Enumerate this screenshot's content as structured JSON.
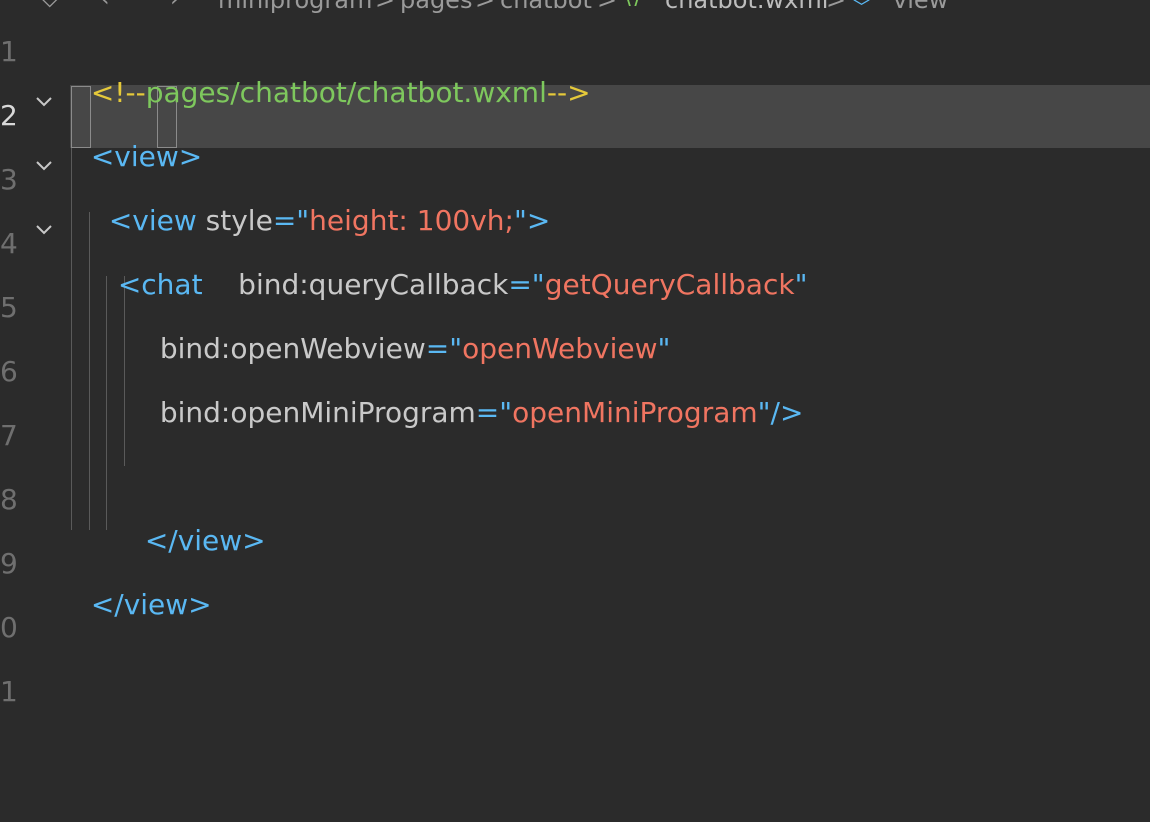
{
  "breadcrumb": {
    "items": [
      "miniprogram",
      "pages",
      "chatbot",
      "chatbot.wxml",
      "view"
    ],
    "separator": ">"
  },
  "gutter": {
    "line_numbers": [
      "1",
      "2",
      "3",
      "4",
      "5",
      "6",
      "7",
      "8",
      "9",
      "0",
      "1"
    ],
    "active_line": "2"
  },
  "code": {
    "line1": {
      "open": "<!--",
      "text": "pages/chatbot/chatbot.wxml",
      "close": "-->"
    },
    "line2": {
      "lt": "<",
      "name": "view",
      "gt": ">"
    },
    "line3": {
      "open": "<view",
      "attr": "style",
      "eq": "=",
      "q1": "\"",
      "value": "height: 100vh;",
      "q2": "\"",
      "close": ">"
    },
    "line4": {
      "open": "<chat",
      "attr": "bind:queryCallback",
      "eq": "=",
      "q1": "\"",
      "value": "getQueryCallback",
      "q2": "\""
    },
    "line5": {
      "attr": "bind:openWebview",
      "eq": "=",
      "q1": "\"",
      "value": "openWebview",
      "q2": "\""
    },
    "line6": {
      "attr": "bind:openMiniProgram",
      "eq": "=",
      "q1": "\"",
      "value": "openMiniProgram",
      "q2": "\"",
      "close": "/>"
    },
    "line8": {
      "text": "</view>"
    },
    "line9": {
      "text": "</view>"
    }
  },
  "colors": {
    "background": "#2b2b2b",
    "current_line": "#474747",
    "tag": "#5ab8f3",
    "string": "#f07561",
    "attribute": "#c9c9c9",
    "comment_bracket": "#e5c93a",
    "comment_text": "#7ec85d"
  }
}
